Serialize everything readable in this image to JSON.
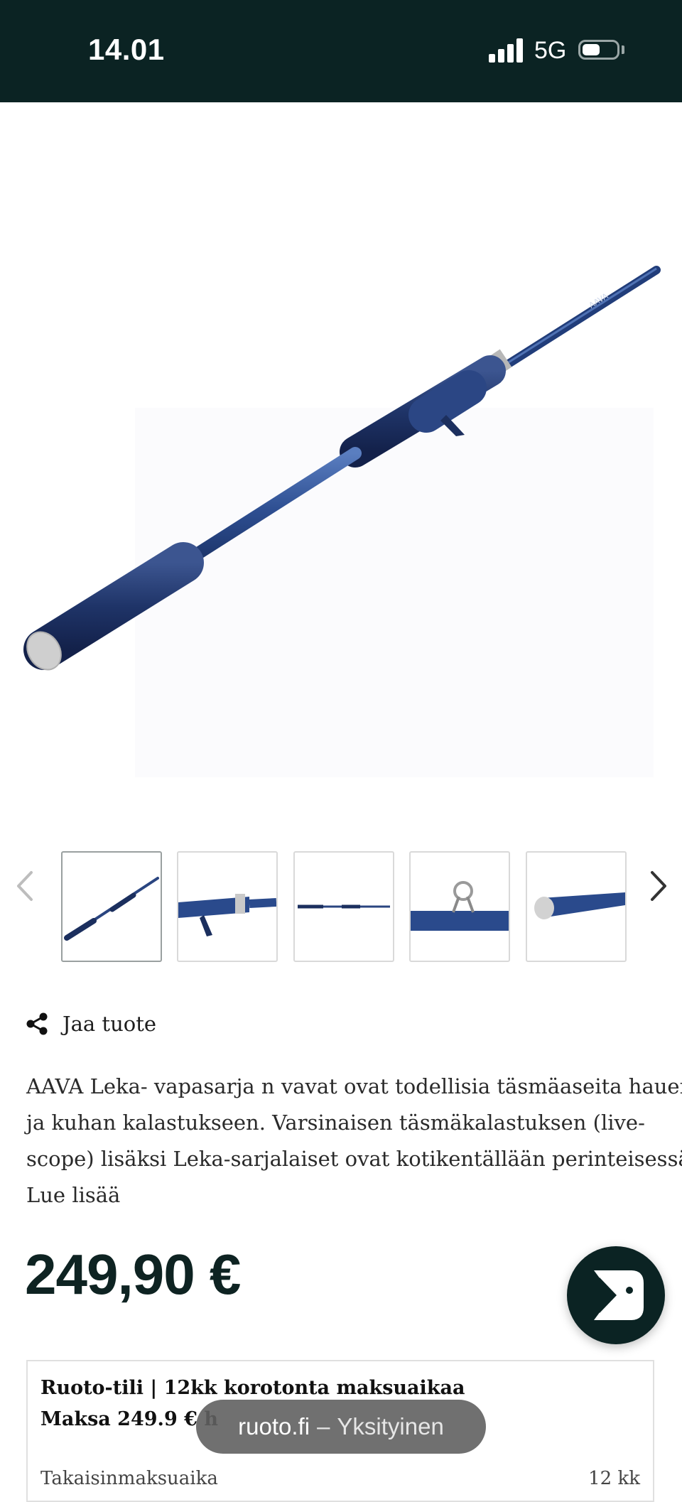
{
  "status_bar": {
    "time": "14.01",
    "network": "5G"
  },
  "product": {
    "image_alt": "AAVA Leka casting rod",
    "thumbnails": [
      {
        "name": "thumb-full-rod"
      },
      {
        "name": "thumb-reel-seat"
      },
      {
        "name": "thumb-rod-overview"
      },
      {
        "name": "thumb-line-guide"
      },
      {
        "name": "thumb-butt-grip"
      }
    ],
    "share_label": "Jaa tuote",
    "description_lines": [
      "AAVA Leka- vapasarja n vavat ovat todellisia täsmäaseita hauen",
      "ja kuhan kalastukseen. Varsinaisen täsmäkalastuksen (live-",
      "scope) lisäksi Leka-sarjalaiset ovat kotikentällään perinteisessä…"
    ],
    "read_more": "Lue lisää",
    "price": "249,90 €"
  },
  "finance": {
    "title": "Ruoto-tili | 12kk korotonta maksuaikaa",
    "subtitle": "Maksa 249.9 € h",
    "row_label": "Takaisinmaksuaika",
    "row_value": "12 kk"
  },
  "browser": {
    "domain": "ruoto.fi",
    "separator": "–",
    "mode": "Yksityinen"
  },
  "colors": {
    "brand_dark": "#0b2323",
    "rod_blue": "#2a4a8c"
  }
}
